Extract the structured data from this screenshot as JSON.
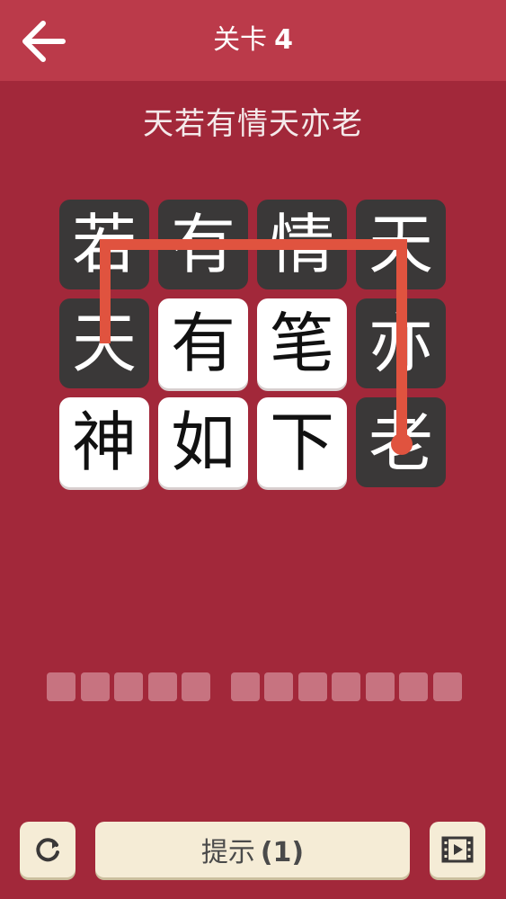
{
  "header": {
    "title_prefix": "关卡",
    "level": "4"
  },
  "target_phrase": "天若有情天亦老",
  "grid": {
    "rows": [
      [
        {
          "char": "若",
          "style": "dark"
        },
        {
          "char": "有",
          "style": "dark"
        },
        {
          "char": "情",
          "style": "dark"
        },
        {
          "char": "天",
          "style": "dark"
        }
      ],
      [
        {
          "char": "天",
          "style": "dark"
        },
        {
          "char": "有",
          "style": "light"
        },
        {
          "char": "笔",
          "style": "light"
        },
        {
          "char": "亦",
          "style": "dark"
        }
      ],
      [
        {
          "char": "神",
          "style": "light"
        },
        {
          "char": "如",
          "style": "light"
        },
        {
          "char": "下",
          "style": "light"
        },
        {
          "char": "老",
          "style": "dark"
        }
      ]
    ]
  },
  "answer_slots": {
    "groups": [
      5,
      7
    ]
  },
  "bottom_bar": {
    "hint_label": "提示",
    "hint_count": "(1)",
    "restart_icon": "restart-icon",
    "video_icon": "film-icon"
  },
  "colors": {
    "background": "#a2283a",
    "header": "#bb3a4a",
    "tile_dark": "#3a3838",
    "tile_light": "#ffffff",
    "path": "#e0533f",
    "slot": "#c77380",
    "button": "#f5ecd6"
  }
}
